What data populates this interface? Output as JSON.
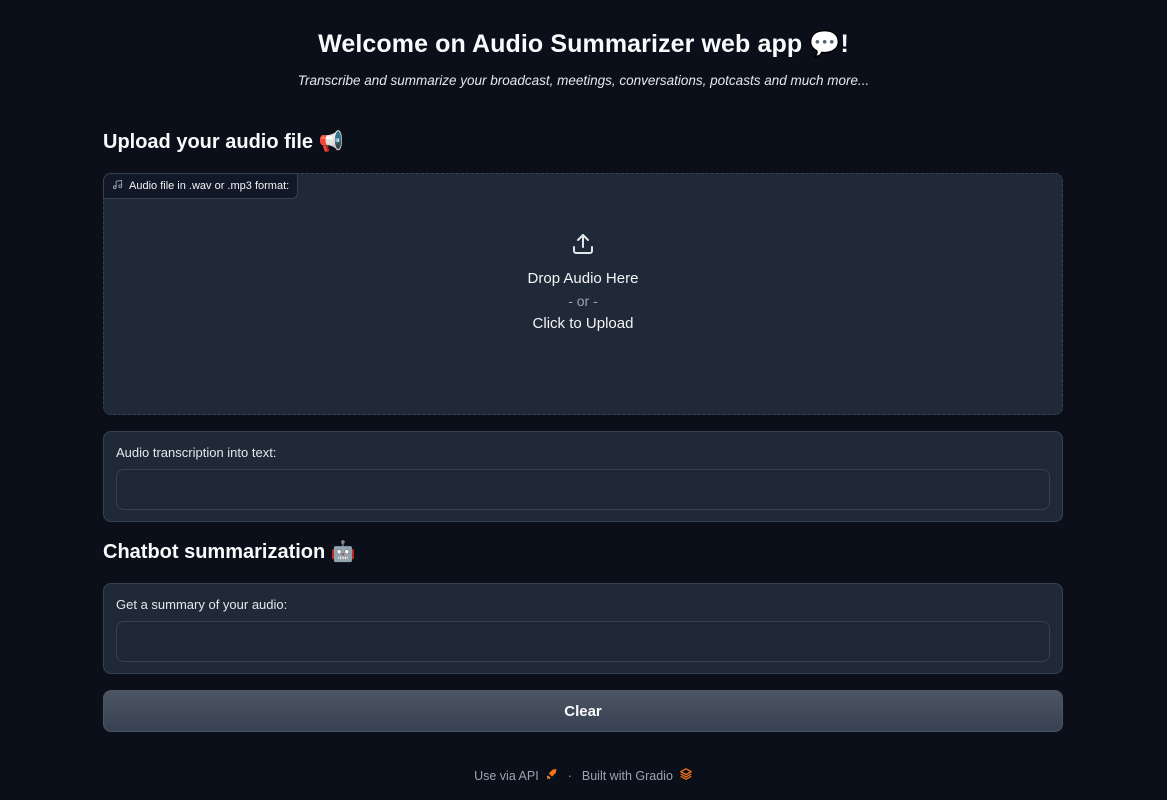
{
  "header": {
    "title": "Welcome on Audio Summarizer web app 💬!",
    "subtitle": "Transcribe and summarize your broadcast, meetings, conversations, potcasts and much more..."
  },
  "upload_section": {
    "title": "Upload your audio file 📢",
    "audio_label": "Audio file in .wav or .mp3 format:",
    "drop_text": "Drop Audio Here",
    "or_text": "- or -",
    "click_text": "Click to Upload"
  },
  "transcription": {
    "label": "Audio transcription into text:",
    "value": ""
  },
  "chatbot_section": {
    "title": "Chatbot summarization 🤖",
    "summary_label": "Get a summary of your audio:",
    "summary_value": ""
  },
  "actions": {
    "clear_label": "Clear"
  },
  "footer": {
    "api_label": "Use via API",
    "separator": "·",
    "built_label": "Built with Gradio"
  },
  "icons": {
    "music_note": "music-note-icon",
    "upload": "upload-icon",
    "rocket": "rocket-icon",
    "gradio_logo": "gradio-logo-icon"
  }
}
